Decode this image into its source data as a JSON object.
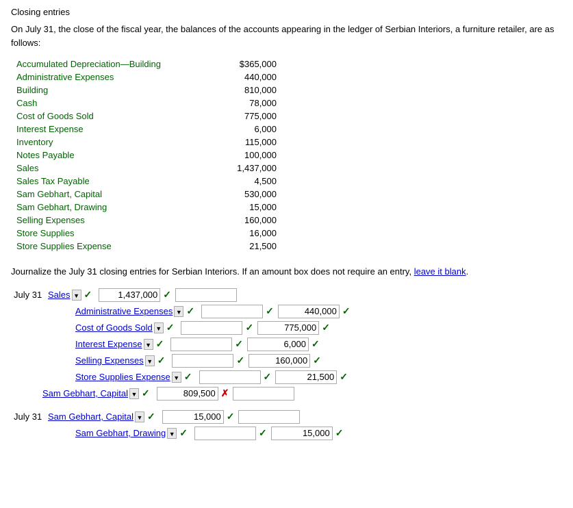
{
  "title": "Closing entries",
  "intro": "On July 31, the close of the fiscal year, the balances of the accounts appearing in the ledger of Serbian Interiors, a furniture retailer, are as follows:",
  "accounts": [
    {
      "name": "Accumulated Depreciation—Building",
      "value": "$365,000"
    },
    {
      "name": "Administrative Expenses",
      "value": "440,000"
    },
    {
      "name": "Building",
      "value": "810,000"
    },
    {
      "name": "Cash",
      "value": "78,000"
    },
    {
      "name": "Cost of Goods Sold",
      "value": "775,000"
    },
    {
      "name": "Interest Expense",
      "value": "6,000"
    },
    {
      "name": "Inventory",
      "value": "115,000"
    },
    {
      "name": "Notes Payable",
      "value": "100,000"
    },
    {
      "name": "Sales",
      "value": "1,437,000"
    },
    {
      "name": "Sales Tax Payable",
      "value": "4,500"
    },
    {
      "name": "Sam Gebhart, Capital",
      "value": "530,000"
    },
    {
      "name": "Sam Gebhart, Drawing",
      "value": "15,000"
    },
    {
      "name": "Selling Expenses",
      "value": "160,000"
    },
    {
      "name": "Store Supplies",
      "value": "16,000"
    },
    {
      "name": "Store Supplies Expense",
      "value": "21,500"
    }
  ],
  "instruction": "Journalize the July 31 closing entries for Serbian Interiors. If an amount box does not require an entry, leave it blank.",
  "entry1": {
    "date": "July 31",
    "debit_account": "Sales",
    "debit_value": "1,437,000",
    "credit_rows": [
      {
        "name": "Administrative Expenses",
        "value": "440,000"
      },
      {
        "name": "Cost of Goods Sold",
        "value": "775,000"
      },
      {
        "name": "Interest Expense",
        "value": "6,000"
      },
      {
        "name": "Selling Expenses",
        "value": "160,000"
      },
      {
        "name": "Store Supplies Expense",
        "value": "21,500"
      }
    ],
    "capital_row": {
      "name": "Sam Gebhart, Capital",
      "debit_value": "809,500",
      "credit_empty": true
    }
  },
  "entry2": {
    "date": "July 31",
    "debit_account": "Sam Gebhart, Capital",
    "debit_value": "15,000",
    "credit_rows": [
      {
        "name": "Sam Gebhart, Drawing",
        "value": "15,000"
      }
    ]
  },
  "symbols": {
    "check": "✓",
    "cross": "✗",
    "dropdown": "▼"
  }
}
